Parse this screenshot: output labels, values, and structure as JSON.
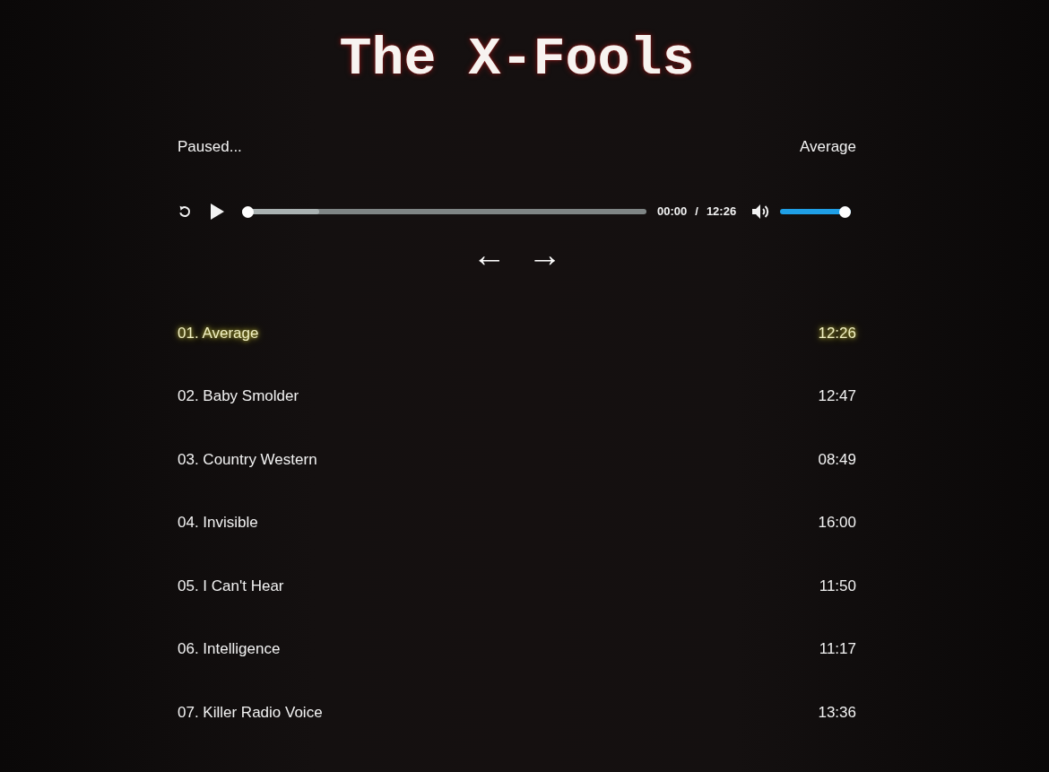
{
  "title": "The X-Fools",
  "status": {
    "state_text": "Paused...",
    "now_playing": "Average"
  },
  "player": {
    "playing": false,
    "progress": {
      "level": 0,
      "buffered": {
        "level": 0.19
      }
    },
    "time": {
      "current": "00:00",
      "separator": "/",
      "total": "12:26"
    },
    "volume": {
      "muted": false,
      "level": 1
    }
  },
  "nav": {
    "previous": "←",
    "next": "→"
  },
  "tracks": [
    {
      "label": "01. Average",
      "duration": "12:26",
      "selected": true
    },
    {
      "label": "02. Baby Smolder",
      "duration": "12:47",
      "selected": false
    },
    {
      "label": "03. Country Western",
      "duration": "08:49",
      "selected": false
    },
    {
      "label": "04. Invisible",
      "duration": "16:00",
      "selected": false
    },
    {
      "label": "05. I Can't Hear",
      "duration": "11:50",
      "selected": false
    },
    {
      "label": "06. Intelligence",
      "duration": "11:17",
      "selected": false
    },
    {
      "label": "07. Killer Radio Voice",
      "duration": "13:36",
      "selected": false
    }
  ]
}
